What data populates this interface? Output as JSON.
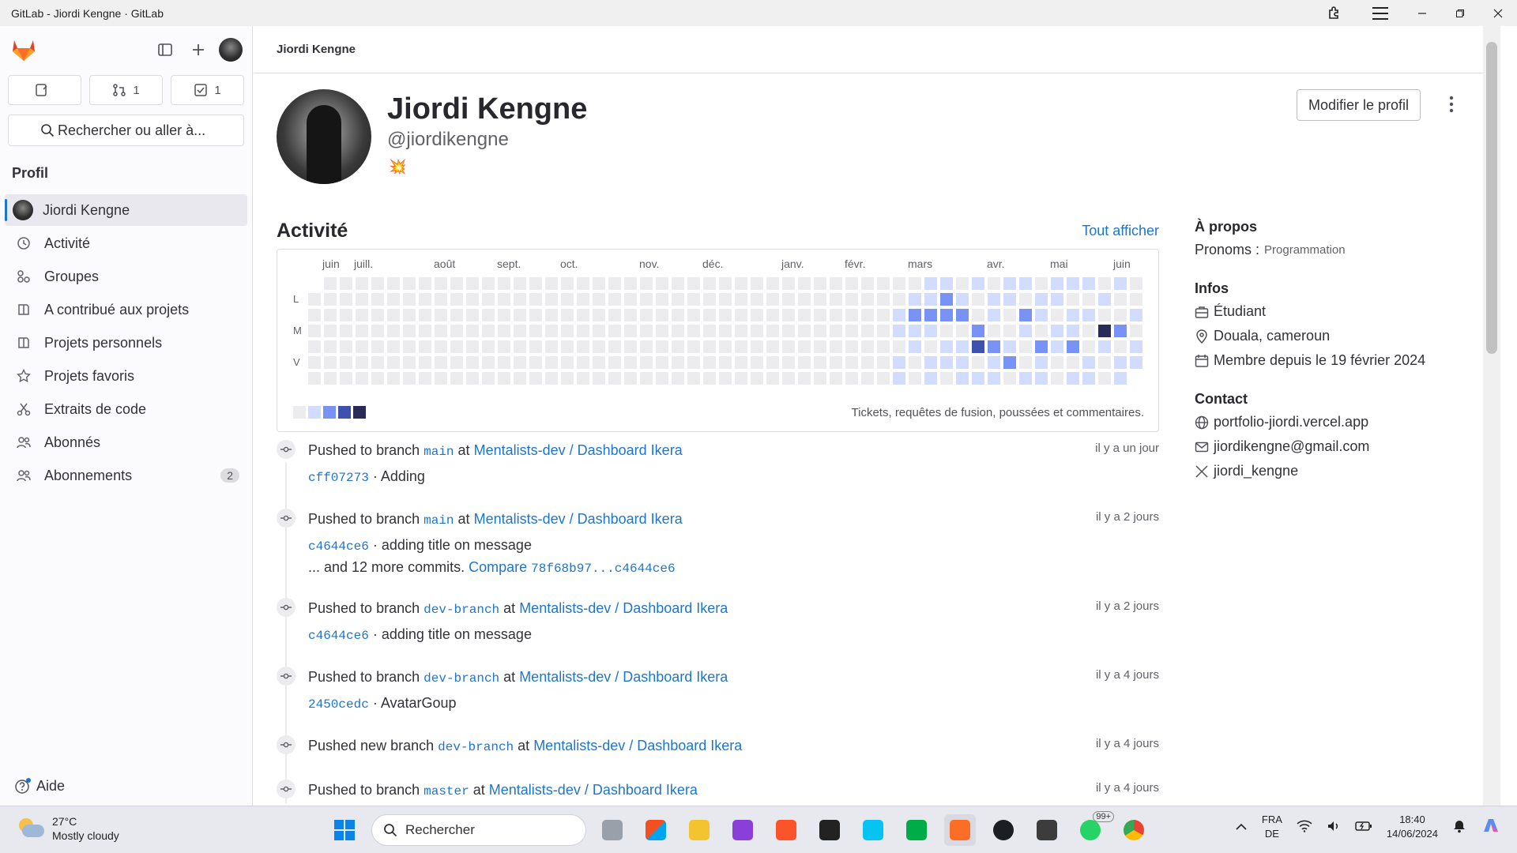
{
  "window": {
    "title": "GitLab - Jiordi Kengne · GitLab"
  },
  "sidebar": {
    "counters": [
      {
        "icon": "issues-icon",
        "count": ""
      },
      {
        "icon": "merge-request-icon",
        "count": "1"
      },
      {
        "icon": "todo-icon",
        "count": "1"
      }
    ],
    "search_label": "Rechercher ou aller à...",
    "section_title": "Profil",
    "items": [
      {
        "label": "Jiordi Kengne",
        "icon": "avatar"
      },
      {
        "label": "Activité",
        "icon": "history-icon"
      },
      {
        "label": "Groupes",
        "icon": "group-icon"
      },
      {
        "label": "A contribué aux projets",
        "icon": "project-icon"
      },
      {
        "label": "Projets personnels",
        "icon": "project-icon"
      },
      {
        "label": "Projets favoris",
        "icon": "star-icon"
      },
      {
        "label": "Extraits de code",
        "icon": "snippet-icon"
      },
      {
        "label": "Abonnés",
        "icon": "users-icon"
      },
      {
        "label": "Abonnements",
        "icon": "users-icon",
        "badge": "2"
      }
    ],
    "help_label": "Aide"
  },
  "breadcrumb": "Jiordi Kengne",
  "profile": {
    "name": "Jiordi Kengne",
    "handle": "@jiordikengne",
    "status_emoji": "💥",
    "edit_label": "Modifier le profil"
  },
  "activity": {
    "title": "Activité",
    "view_all": "Tout afficher",
    "months": [
      "juin",
      "juill.",
      "août",
      "sept.",
      "oct.",
      "nov.",
      "déc.",
      "janv.",
      "févr.",
      "mars",
      "avr.",
      "mai",
      "juin"
    ],
    "days": [
      "L",
      "M",
      "V"
    ],
    "legend_note": "Tickets, requêtes de fusion, poussées et commentaires.",
    "levels": [
      "#ececef",
      "#d2dcff",
      "#7992f5",
      "#3f51ae",
      "#2a2b59"
    ]
  },
  "events": [
    {
      "prefix": "Pushed to branch",
      "branch": "main",
      "at": "at",
      "project": "Mentalists-dev / Dashboard Ikera",
      "time": "il y a un jour",
      "sha": "cff07273",
      "msg": "· Adding",
      "extra_text": "",
      "compare_label": "",
      "compare_range": ""
    },
    {
      "prefix": "Pushed to branch",
      "branch": "main",
      "at": "at",
      "project": "Mentalists-dev / Dashboard Ikera",
      "time": "il y a 2 jours",
      "sha": "c4644ce6",
      "msg": "· adding title on message",
      "extra_text": "... and 12 more commits.",
      "compare_label": "Compare",
      "compare_range": "78f68b97...c4644ce6"
    },
    {
      "prefix": "Pushed to branch",
      "branch": "dev-branch",
      "at": "at",
      "project": "Mentalists-dev / Dashboard Ikera",
      "time": "il y a 2 jours",
      "sha": "c4644ce6",
      "msg": "· adding title on message",
      "extra_text": "",
      "compare_label": "",
      "compare_range": ""
    },
    {
      "prefix": "Pushed to branch",
      "branch": "dev-branch",
      "at": "at",
      "project": "Mentalists-dev / Dashboard Ikera",
      "time": "il y a 4 jours",
      "sha": "2450cedc",
      "msg": "· AvatarGoup",
      "extra_text": "",
      "compare_label": "",
      "compare_range": ""
    },
    {
      "prefix": "Pushed new branch",
      "branch": "dev-branch",
      "at": "at",
      "project": "Mentalists-dev / Dashboard Ikera",
      "time": "il y a 4 jours",
      "sha": "",
      "msg": "",
      "extra_text": "",
      "compare_label": "",
      "compare_range": ""
    },
    {
      "prefix": "Pushed to branch",
      "branch": "master",
      "at": "at",
      "project": "Mentalists-dev / Dashboard Ikera",
      "time": "il y a 4 jours",
      "sha": "",
      "msg": "",
      "extra_text": "",
      "compare_label": "",
      "compare_range": ""
    }
  ],
  "about": {
    "title": "À propos",
    "pronouns_label": "Pronoms :",
    "pronouns_value": "Programmation",
    "infos_title": "Infos",
    "job": "Étudiant",
    "location": "Douala, cameroun",
    "member_since": "Membre depuis le 19 février 2024",
    "contact_title": "Contact",
    "website": "portfolio-jiordi.vercel.app",
    "email": "jiordikengne@gmail.com",
    "twitter": "jiordi_kengne"
  },
  "taskbar": {
    "temp": "27°C",
    "weather": "Mostly cloudy",
    "search": "Rechercher",
    "lang1": "FRA",
    "lang2": "DE",
    "time": "18:40",
    "date": "14/06/2024",
    "whatsapp_badge": "99+"
  }
}
